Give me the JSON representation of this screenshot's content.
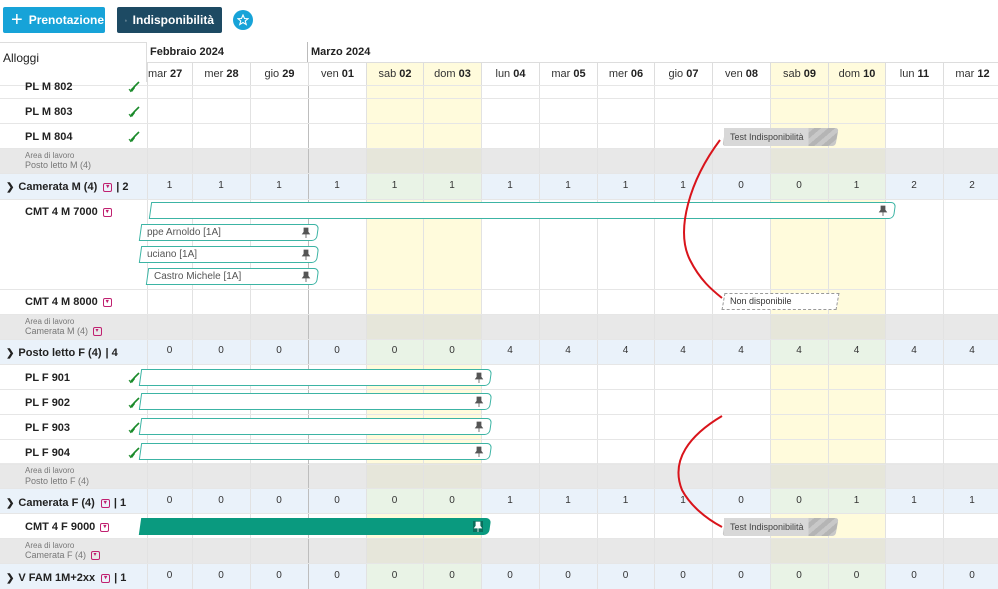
{
  "toolbar": {
    "prenotazione_label": "Prenotazione",
    "indisponibilita_label": "Indisponibilità"
  },
  "header": {
    "alloggi_label": "Alloggi",
    "months": [
      "Febbraio 2024",
      "Marzo 2024"
    ],
    "days": [
      {
        "dow": "mar",
        "num": "27"
      },
      {
        "dow": "mer",
        "num": "28"
      },
      {
        "dow": "gio",
        "num": "29"
      },
      {
        "dow": "ven",
        "num": "01"
      },
      {
        "dow": "sab",
        "num": "02"
      },
      {
        "dow": "dom",
        "num": "03"
      },
      {
        "dow": "lun",
        "num": "04"
      },
      {
        "dow": "mar",
        "num": "05"
      },
      {
        "dow": "mer",
        "num": "06"
      },
      {
        "dow": "gio",
        "num": "07"
      },
      {
        "dow": "ven",
        "num": "08"
      },
      {
        "dow": "sab",
        "num": "09"
      },
      {
        "dow": "dom",
        "num": "10"
      },
      {
        "dow": "lun",
        "num": "11"
      },
      {
        "dow": "mar",
        "num": "12"
      }
    ]
  },
  "rows": {
    "plm802": "PL M 802",
    "plm803": "PL M 803",
    "plm804": "PL M 804",
    "area_label": "Area di lavoro",
    "area_postoletto_m": "Posto letto M (4)",
    "grp_camerata_m": "Camerata M (4)",
    "grp_camerata_m_count": "| 2",
    "cmt4m7000": "CMT 4 M 7000",
    "cmt4m8000": "CMT 4 M 8000",
    "area_camerata_m": "Camerata M (4)",
    "grp_postoletto_f": "Posto letto F (4)",
    "grp_postoletto_f_count": "| 4",
    "plf901": "PL F 901",
    "plf902": "PL F 902",
    "plf903": "PL F 903",
    "plf904": "PL F 904",
    "area_postoletto_f": "Posto letto F (4)",
    "grp_camerata_f": "Camerata F (4)",
    "grp_camerata_f_count": "| 1",
    "cmt4f9000": "CMT 4 F 9000",
    "area_camerata_f": "Camerata F (4)",
    "grp_vfam": "V FAM 1M+2xx",
    "grp_vfam_count": "| 1"
  },
  "counts": {
    "camerata_m": [
      "1",
      "1",
      "1",
      "1",
      "1",
      "1",
      "1",
      "1",
      "1",
      "1",
      "0",
      "0",
      "1",
      "2",
      "2"
    ],
    "postoletto_f": [
      "0",
      "0",
      "0",
      "0",
      "0",
      "0",
      "4",
      "4",
      "4",
      "4",
      "4",
      "4",
      "4",
      "4",
      "4"
    ],
    "camerata_f": [
      "0",
      "0",
      "0",
      "0",
      "0",
      "0",
      "1",
      "1",
      "1",
      "1",
      "0",
      "0",
      "1",
      "1",
      "1"
    ],
    "vfam": [
      "0",
      "0",
      "0",
      "0",
      "0",
      "0",
      "0",
      "0",
      "0",
      "0",
      "0",
      "0",
      "0",
      "0",
      "0"
    ]
  },
  "bookings": {
    "arnoldo": "ppe Arnoldo [1A]",
    "luciano": "uciano [1A]",
    "castro": "Castro Michele [1A]"
  },
  "unavailability": {
    "test1": "Test Indisponibilità",
    "nondisp": "Non disponibile",
    "test2": "Test Indisponibilità"
  },
  "colors": {
    "primary": "#17a3d8",
    "dark": "#1d4a63",
    "booking_border": "#3cb4a4",
    "booking_solid": "#0a9a7f",
    "weekend": "#fffbdc",
    "annotation": "#d9141b"
  }
}
